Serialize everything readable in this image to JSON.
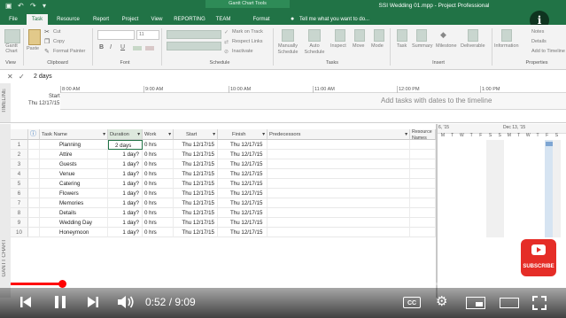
{
  "window": {
    "title": "SSI Wedding 01.mpp - Project Professional",
    "context_band": "Gantt Chart Tools",
    "tell_me": "Tell me what you want to do..."
  },
  "tabs": [
    "File",
    "Task",
    "Resource",
    "Report",
    "Project",
    "View",
    "REPORTING",
    "TEAM",
    "Format"
  ],
  "ribbon": {
    "view_group": {
      "button": "Gantt Chart",
      "label": "View"
    },
    "clipboard": {
      "paste": "Paste",
      "cut": "Cut",
      "copy": "Copy",
      "format_painter": "Format Painter",
      "label": "Clipboard"
    },
    "font": {
      "size": "11",
      "bold": "B",
      "italic": "I",
      "underline": "U",
      "label": "Font"
    },
    "schedule": {
      "mark_on_track": "Mark on Track",
      "respect_links": "Respect Links",
      "inactivate": "Inactivate",
      "label": "Schedule"
    },
    "tasks": {
      "manually": "Manually Schedule",
      "auto": "Auto Schedule",
      "inspect": "Inspect",
      "move": "Move",
      "mode": "Mode",
      "label": "Tasks"
    },
    "insert": {
      "task": "Task",
      "summary": "Summary",
      "milestone": "Milestone",
      "deliverable": "Deliverable",
      "label": "Insert"
    },
    "properties": {
      "information": "Information",
      "notes": "Notes",
      "details": "Details",
      "add_to_timeline": "Add to Timeline",
      "label": "Properties"
    }
  },
  "entry_bar": {
    "value": "2 days"
  },
  "timeline": {
    "side_label": "TIMELINE",
    "start_label": "Start",
    "start_date": "Thu 12/17/15",
    "ticks": [
      "8:00 AM",
      "9:00 AM",
      "10:00 AM",
      "11:00 AM",
      "12:00 PM",
      "1:00 PM"
    ],
    "placeholder": "Add tasks with dates to the timeline"
  },
  "side_label": "GANTT CHART",
  "table": {
    "columns": [
      "Task Name",
      "Duration",
      "Work",
      "Start",
      "Finish",
      "Predecessors",
      "Resource Names"
    ],
    "rows": [
      {
        "id": "1",
        "name": "Planning",
        "duration": "2 days",
        "work": "0 hrs",
        "start": "Thu 12/17/15",
        "finish": "Thu 12/17/15"
      },
      {
        "id": "2",
        "name": "Attire",
        "duration": "1 day?",
        "work": "0 hrs",
        "start": "Thu 12/17/15",
        "finish": "Thu 12/17/15"
      },
      {
        "id": "3",
        "name": "Guests",
        "duration": "1 day?",
        "work": "0 hrs",
        "start": "Thu 12/17/15",
        "finish": "Thu 12/17/15"
      },
      {
        "id": "4",
        "name": "Venue",
        "duration": "1 day?",
        "work": "0 hrs",
        "start": "Thu 12/17/15",
        "finish": "Thu 12/17/15"
      },
      {
        "id": "5",
        "name": "Catering",
        "duration": "1 day?",
        "work": "0 hrs",
        "start": "Thu 12/17/15",
        "finish": "Thu 12/17/15"
      },
      {
        "id": "6",
        "name": "Flowers",
        "duration": "1 day?",
        "work": "0 hrs",
        "start": "Thu 12/17/15",
        "finish": "Thu 12/17/15"
      },
      {
        "id": "7",
        "name": "Memories",
        "duration": "1 day?",
        "work": "0 hrs",
        "start": "Thu 12/17/15",
        "finish": "Thu 12/17/15"
      },
      {
        "id": "8",
        "name": "Details",
        "duration": "1 day?",
        "work": "0 hrs",
        "start": "Thu 12/17/15",
        "finish": "Thu 12/17/15"
      },
      {
        "id": "9",
        "name": "Wedding Day",
        "duration": "1 day?",
        "work": "0 hrs",
        "start": "Thu 12/17/15",
        "finish": "Thu 12/17/15"
      },
      {
        "id": "10",
        "name": "Honeymoon",
        "duration": "1 day?",
        "work": "0 hrs",
        "start": "Thu 12/17/15",
        "finish": "Thu 12/17/15"
      }
    ]
  },
  "chart": {
    "weeks": [
      "6, '15",
      "Dec 13, '15"
    ],
    "days": [
      "M",
      "T",
      "W",
      "T",
      "F",
      "S",
      "S",
      "M",
      "T",
      "W",
      "T",
      "F",
      "S"
    ]
  },
  "video": {
    "time": "0:52 / 9:09",
    "progress_fraction": 0.095,
    "subscribe": "SUBSCRIBE",
    "accent": "#ff0000"
  }
}
